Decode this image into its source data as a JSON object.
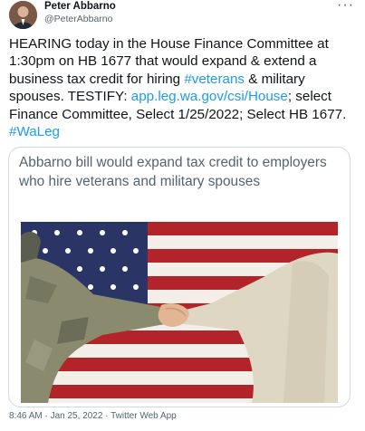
{
  "author": {
    "name": "Peter Abbarno",
    "handle": "@PeterAbbarno"
  },
  "menu_icon": "more-dots-icon",
  "tweet": {
    "text_1": "HEARING today in the House Finance Committee at 1:30pm on HB 1677 that would expand & extend a business tax credit for hiring ",
    "hashtag_1": "#veterans",
    "text_2": " & military spouses. TESTIFY: ",
    "link": "app.leg.wa.gov/csi/House",
    "text_3": "; select Finance Committee, Select 1/25/2022; Select HB 1677. ",
    "hashtag_2": "#WaLeg"
  },
  "card": {
    "title": "Abbarno bill would expand tax credit to employers who hire veterans and military spouses"
  },
  "meta": {
    "timestamp": "8:46 AM · Jan 25, 2022 · Twitter Web App"
  },
  "colors": {
    "link": "#1d9bf0",
    "text": "#0f1419",
    "secondary": "#536471"
  }
}
